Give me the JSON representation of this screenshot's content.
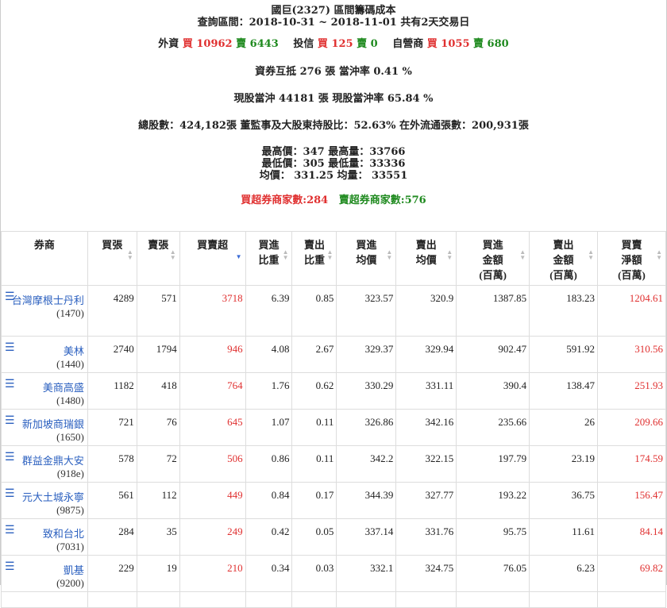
{
  "header": {
    "title": "國巨(2327) 區間籌碼成本",
    "range": "查詢區間：2018-10-31 ~ 2018-11-01 共有2天交易日",
    "institutions": [
      {
        "name": "外資",
        "buy": "買 10962",
        "sell": "賣 6443"
      },
      {
        "name": "投信",
        "buy": "買 125",
        "sell": "賣 0"
      },
      {
        "name": "自營商",
        "buy": "買 1055",
        "sell": "賣 680"
      }
    ],
    "margin_line": "資券互抵 276 張  當沖率 0.41 %",
    "daytrade_line": "現股當沖 44181 張  現股當沖率 65.84 %",
    "shares_line": "總股數：424,182張    董監事及大股東持股比：52.63%    在外流通張數：200,931張",
    "price_lines": [
      "最高價：347    最高量：33766",
      "最低價：305    最低量：33336",
      "均價：  331.25    均量：  33551"
    ],
    "buy_brokers": "買超券商家數:284",
    "sell_brokers": "賣超券商家數:576"
  },
  "table": {
    "columns": [
      {
        "label": "券商",
        "sort": false
      },
      {
        "label": "買張",
        "sort": true
      },
      {
        "label": "賣張",
        "sort": true
      },
      {
        "label": "買賣超",
        "sort": "desc"
      },
      {
        "label": "買進\n比重",
        "sort": true
      },
      {
        "label": "賣出\n比重",
        "sort": true
      },
      {
        "label": "買進\n均價",
        "sort": true
      },
      {
        "label": "賣出\n均價",
        "sort": true
      },
      {
        "label": "買進\n金額\n(百萬)",
        "sort": true
      },
      {
        "label": "賣出\n金額\n(百萬)",
        "sort": true
      },
      {
        "label": "買賣\n淨額\n(百萬)",
        "sort": true
      }
    ],
    "rows": [
      {
        "name": "台灣摩根士丹利",
        "code": "(1470)",
        "buy": "4289",
        "sell": "571",
        "net": "3718",
        "buy_pct": "6.39",
        "sell_pct": "0.85",
        "buy_avg": "323.57",
        "sell_avg": "320.9",
        "buy_amt": "1387.85",
        "sell_amt": "183.23",
        "net_amt": "1204.61"
      },
      {
        "name": "美林",
        "code": "(1440)",
        "buy": "2740",
        "sell": "1794",
        "net": "946",
        "buy_pct": "4.08",
        "sell_pct": "2.67",
        "buy_avg": "329.37",
        "sell_avg": "329.94",
        "buy_amt": "902.47",
        "sell_amt": "591.92",
        "net_amt": "310.56"
      },
      {
        "name": "美商高盛",
        "code": "(1480)",
        "buy": "1182",
        "sell": "418",
        "net": "764",
        "buy_pct": "1.76",
        "sell_pct": "0.62",
        "buy_avg": "330.29",
        "sell_avg": "331.11",
        "buy_amt": "390.4",
        "sell_amt": "138.47",
        "net_amt": "251.93"
      },
      {
        "name": "新加坡商瑞銀",
        "code": "(1650)",
        "buy": "721",
        "sell": "76",
        "net": "645",
        "buy_pct": "1.07",
        "sell_pct": "0.11",
        "buy_avg": "326.86",
        "sell_avg": "342.16",
        "buy_amt": "235.66",
        "sell_amt": "26",
        "net_amt": "209.66"
      },
      {
        "name": "群益金鼎大安",
        "code": "(918e)",
        "buy": "578",
        "sell": "72",
        "net": "506",
        "buy_pct": "0.86",
        "sell_pct": "0.11",
        "buy_avg": "342.2",
        "sell_avg": "322.15",
        "buy_amt": "197.79",
        "sell_amt": "23.19",
        "net_amt": "174.59"
      },
      {
        "name": "元大土城永寧",
        "code": "(9875)",
        "buy": "561",
        "sell": "112",
        "net": "449",
        "buy_pct": "0.84",
        "sell_pct": "0.17",
        "buy_avg": "344.39",
        "sell_avg": "327.77",
        "buy_amt": "193.22",
        "sell_amt": "36.75",
        "net_amt": "156.47"
      },
      {
        "name": "致和台北",
        "code": "(7031)",
        "buy": "284",
        "sell": "35",
        "net": "249",
        "buy_pct": "0.42",
        "sell_pct": "0.05",
        "buy_avg": "337.14",
        "sell_avg": "331.76",
        "buy_amt": "95.75",
        "sell_amt": "11.61",
        "net_amt": "84.14"
      },
      {
        "name": "凱基",
        "code": "(9200)",
        "buy": "229",
        "sell": "19",
        "net": "210",
        "buy_pct": "0.34",
        "sell_pct": "0.03",
        "buy_avg": "332.1",
        "sell_avg": "324.75",
        "buy_amt": "76.05",
        "sell_amt": "6.23",
        "net_amt": "69.82"
      }
    ]
  },
  "colors": {
    "buy": "#e03030",
    "sell": "#1f8a1f",
    "link": "#2a5fbf"
  },
  "icons": {
    "row_menu": "list-icon",
    "sort": "sort-icon"
  }
}
